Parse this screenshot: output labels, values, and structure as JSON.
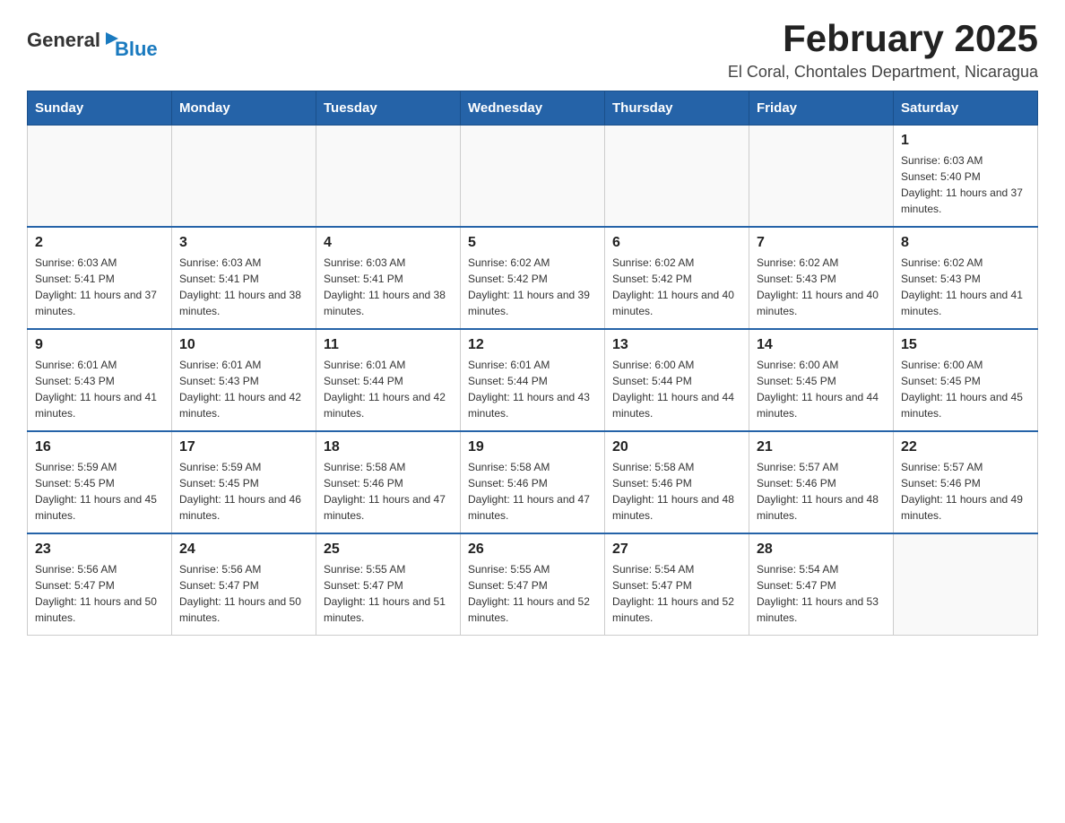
{
  "header": {
    "logo_general": "General",
    "logo_blue": "Blue",
    "title": "February 2025",
    "subtitle": "El Coral, Chontales Department, Nicaragua"
  },
  "calendar": {
    "days_of_week": [
      "Sunday",
      "Monday",
      "Tuesday",
      "Wednesday",
      "Thursday",
      "Friday",
      "Saturday"
    ],
    "weeks": [
      [
        {
          "day": "",
          "info": ""
        },
        {
          "day": "",
          "info": ""
        },
        {
          "day": "",
          "info": ""
        },
        {
          "day": "",
          "info": ""
        },
        {
          "day": "",
          "info": ""
        },
        {
          "day": "",
          "info": ""
        },
        {
          "day": "1",
          "info": "Sunrise: 6:03 AM\nSunset: 5:40 PM\nDaylight: 11 hours and 37 minutes."
        }
      ],
      [
        {
          "day": "2",
          "info": "Sunrise: 6:03 AM\nSunset: 5:41 PM\nDaylight: 11 hours and 37 minutes."
        },
        {
          "day": "3",
          "info": "Sunrise: 6:03 AM\nSunset: 5:41 PM\nDaylight: 11 hours and 38 minutes."
        },
        {
          "day": "4",
          "info": "Sunrise: 6:03 AM\nSunset: 5:41 PM\nDaylight: 11 hours and 38 minutes."
        },
        {
          "day": "5",
          "info": "Sunrise: 6:02 AM\nSunset: 5:42 PM\nDaylight: 11 hours and 39 minutes."
        },
        {
          "day": "6",
          "info": "Sunrise: 6:02 AM\nSunset: 5:42 PM\nDaylight: 11 hours and 40 minutes."
        },
        {
          "day": "7",
          "info": "Sunrise: 6:02 AM\nSunset: 5:43 PM\nDaylight: 11 hours and 40 minutes."
        },
        {
          "day": "8",
          "info": "Sunrise: 6:02 AM\nSunset: 5:43 PM\nDaylight: 11 hours and 41 minutes."
        }
      ],
      [
        {
          "day": "9",
          "info": "Sunrise: 6:01 AM\nSunset: 5:43 PM\nDaylight: 11 hours and 41 minutes."
        },
        {
          "day": "10",
          "info": "Sunrise: 6:01 AM\nSunset: 5:43 PM\nDaylight: 11 hours and 42 minutes."
        },
        {
          "day": "11",
          "info": "Sunrise: 6:01 AM\nSunset: 5:44 PM\nDaylight: 11 hours and 42 minutes."
        },
        {
          "day": "12",
          "info": "Sunrise: 6:01 AM\nSunset: 5:44 PM\nDaylight: 11 hours and 43 minutes."
        },
        {
          "day": "13",
          "info": "Sunrise: 6:00 AM\nSunset: 5:44 PM\nDaylight: 11 hours and 44 minutes."
        },
        {
          "day": "14",
          "info": "Sunrise: 6:00 AM\nSunset: 5:45 PM\nDaylight: 11 hours and 44 minutes."
        },
        {
          "day": "15",
          "info": "Sunrise: 6:00 AM\nSunset: 5:45 PM\nDaylight: 11 hours and 45 minutes."
        }
      ],
      [
        {
          "day": "16",
          "info": "Sunrise: 5:59 AM\nSunset: 5:45 PM\nDaylight: 11 hours and 45 minutes."
        },
        {
          "day": "17",
          "info": "Sunrise: 5:59 AM\nSunset: 5:45 PM\nDaylight: 11 hours and 46 minutes."
        },
        {
          "day": "18",
          "info": "Sunrise: 5:58 AM\nSunset: 5:46 PM\nDaylight: 11 hours and 47 minutes."
        },
        {
          "day": "19",
          "info": "Sunrise: 5:58 AM\nSunset: 5:46 PM\nDaylight: 11 hours and 47 minutes."
        },
        {
          "day": "20",
          "info": "Sunrise: 5:58 AM\nSunset: 5:46 PM\nDaylight: 11 hours and 48 minutes."
        },
        {
          "day": "21",
          "info": "Sunrise: 5:57 AM\nSunset: 5:46 PM\nDaylight: 11 hours and 48 minutes."
        },
        {
          "day": "22",
          "info": "Sunrise: 5:57 AM\nSunset: 5:46 PM\nDaylight: 11 hours and 49 minutes."
        }
      ],
      [
        {
          "day": "23",
          "info": "Sunrise: 5:56 AM\nSunset: 5:47 PM\nDaylight: 11 hours and 50 minutes."
        },
        {
          "day": "24",
          "info": "Sunrise: 5:56 AM\nSunset: 5:47 PM\nDaylight: 11 hours and 50 minutes."
        },
        {
          "day": "25",
          "info": "Sunrise: 5:55 AM\nSunset: 5:47 PM\nDaylight: 11 hours and 51 minutes."
        },
        {
          "day": "26",
          "info": "Sunrise: 5:55 AM\nSunset: 5:47 PM\nDaylight: 11 hours and 52 minutes."
        },
        {
          "day": "27",
          "info": "Sunrise: 5:54 AM\nSunset: 5:47 PM\nDaylight: 11 hours and 52 minutes."
        },
        {
          "day": "28",
          "info": "Sunrise: 5:54 AM\nSunset: 5:47 PM\nDaylight: 11 hours and 53 minutes."
        },
        {
          "day": "",
          "info": ""
        }
      ]
    ]
  }
}
